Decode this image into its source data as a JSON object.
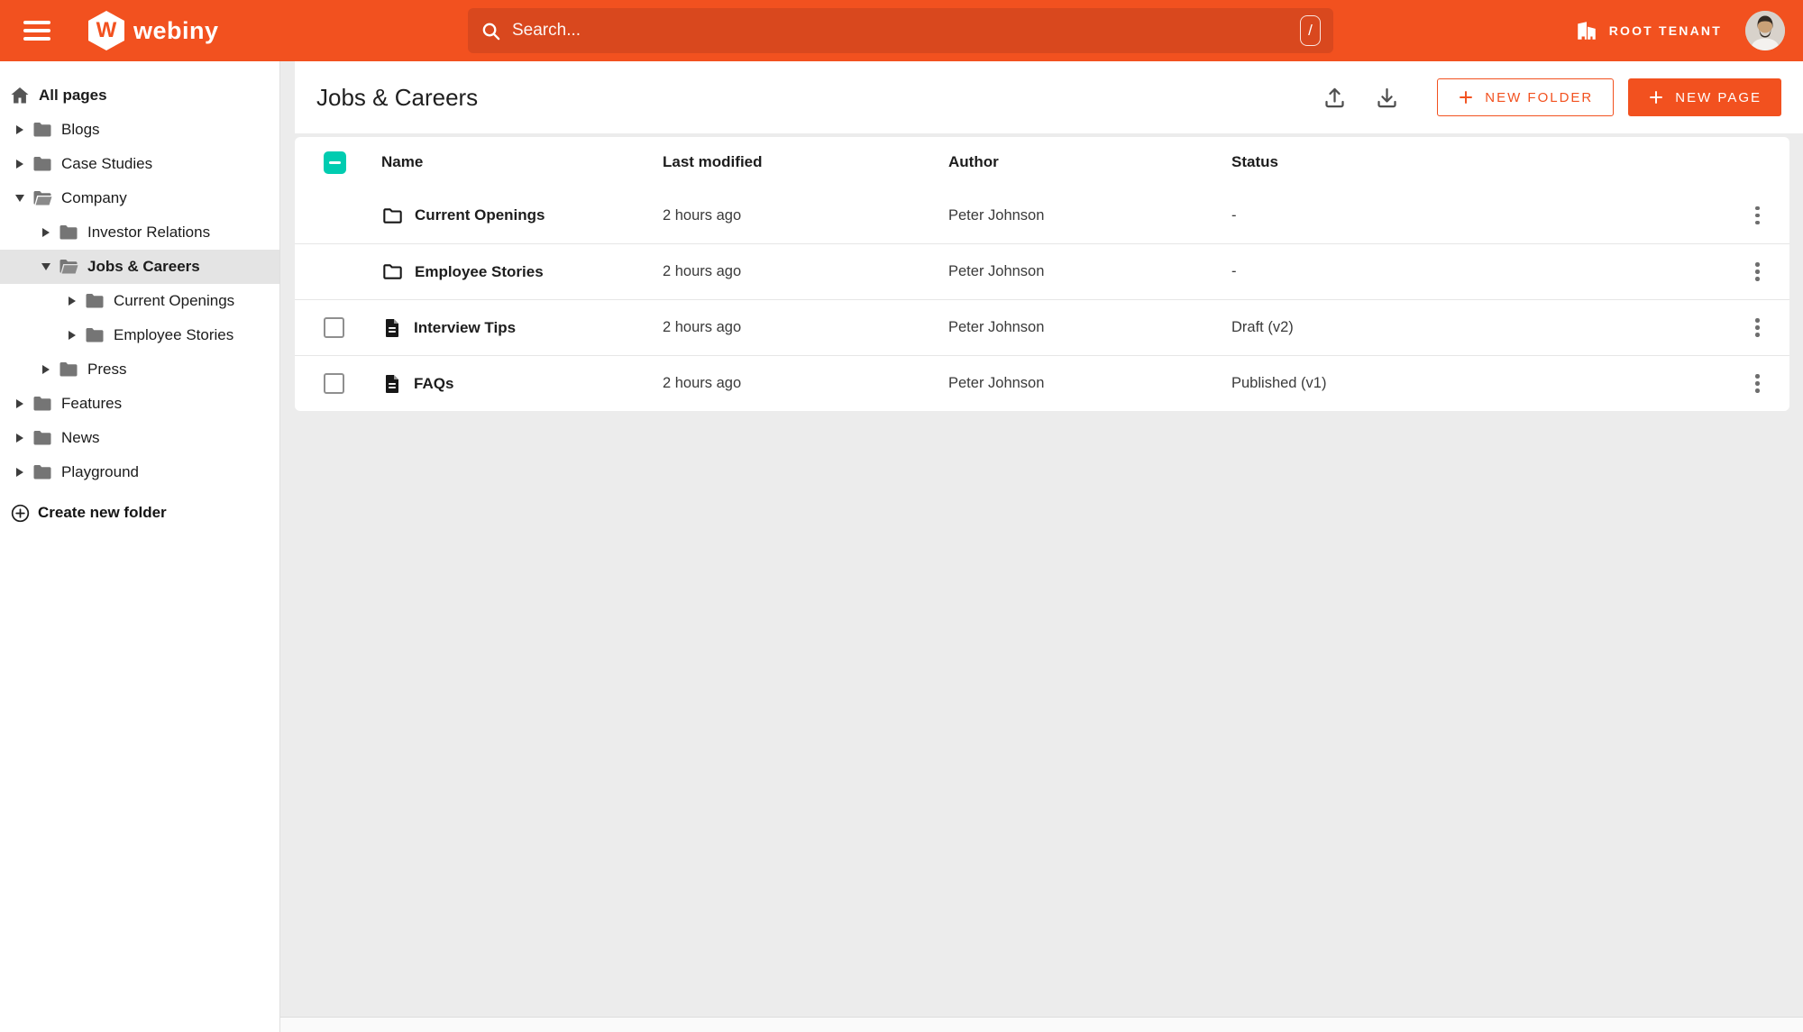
{
  "topbar": {
    "brand": "webiny",
    "logo_letter": "W",
    "search": {
      "placeholder": "Search...",
      "shortcut": "/"
    },
    "tenant_label": "ROOT TENANT"
  },
  "sidebar": {
    "items": [
      {
        "label": "All pages",
        "level": 0,
        "icon": "home",
        "caret": "none",
        "bold": true,
        "selected": false
      },
      {
        "label": "Blogs",
        "level": 1,
        "icon": "folder",
        "caret": "collapsed",
        "bold": false,
        "selected": false
      },
      {
        "label": "Case Studies",
        "level": 1,
        "icon": "folder",
        "caret": "collapsed",
        "bold": false,
        "selected": false
      },
      {
        "label": "Company",
        "level": 1,
        "icon": "folder-open",
        "caret": "expanded",
        "bold": false,
        "selected": false
      },
      {
        "label": "Investor Relations",
        "level": 2,
        "icon": "folder",
        "caret": "collapsed",
        "bold": false,
        "selected": false
      },
      {
        "label": "Jobs & Careers",
        "level": 2,
        "icon": "folder-open",
        "caret": "expanded",
        "bold": true,
        "selected": true
      },
      {
        "label": "Current Openings",
        "level": 3,
        "icon": "folder",
        "caret": "collapsed",
        "bold": false,
        "selected": false
      },
      {
        "label": "Employee Stories",
        "level": 3,
        "icon": "folder",
        "caret": "collapsed",
        "bold": false,
        "selected": false
      },
      {
        "label": "Press",
        "level": 2,
        "icon": "folder",
        "caret": "collapsed",
        "bold": false,
        "selected": false
      },
      {
        "label": "Features",
        "level": 1,
        "icon": "folder",
        "caret": "collapsed",
        "bold": false,
        "selected": false
      },
      {
        "label": "News",
        "level": 1,
        "icon": "folder",
        "caret": "collapsed",
        "bold": false,
        "selected": false
      },
      {
        "label": "Playground",
        "level": 1,
        "icon": "folder",
        "caret": "collapsed",
        "bold": false,
        "selected": false
      }
    ],
    "create_folder_label": "Create new folder"
  },
  "content": {
    "title": "Jobs & Careers",
    "actions": {
      "new_folder": "NEW FOLDER",
      "new_page": "NEW PAGE"
    },
    "table": {
      "columns": [
        "Name",
        "Last modified",
        "Author",
        "Status"
      ],
      "header_checkbox_state": "indeterminate",
      "rows": [
        {
          "name": "Current Openings",
          "type": "folder",
          "modified": "2 hours ago",
          "author": "Peter Johnson",
          "status": "-",
          "checkbox": false,
          "checked": false
        },
        {
          "name": "Employee Stories",
          "type": "folder",
          "modified": "2 hours ago",
          "author": "Peter Johnson",
          "status": "-",
          "checkbox": false,
          "checked": false
        },
        {
          "name": "Interview Tips",
          "type": "page",
          "modified": "2 hours ago",
          "author": "Peter Johnson",
          "status": "Draft (v2)",
          "checkbox": true,
          "checked": false
        },
        {
          "name": "FAQs",
          "type": "page",
          "modified": "2 hours ago",
          "author": "Peter Johnson",
          "status": "Published (v1)",
          "checkbox": true,
          "checked": false
        }
      ]
    }
  },
  "colors": {
    "accent": "#f2511f",
    "secondary_teal": "#00ccb0",
    "topbar_search_bg": "#d9481e",
    "main_bg": "#ececec"
  }
}
